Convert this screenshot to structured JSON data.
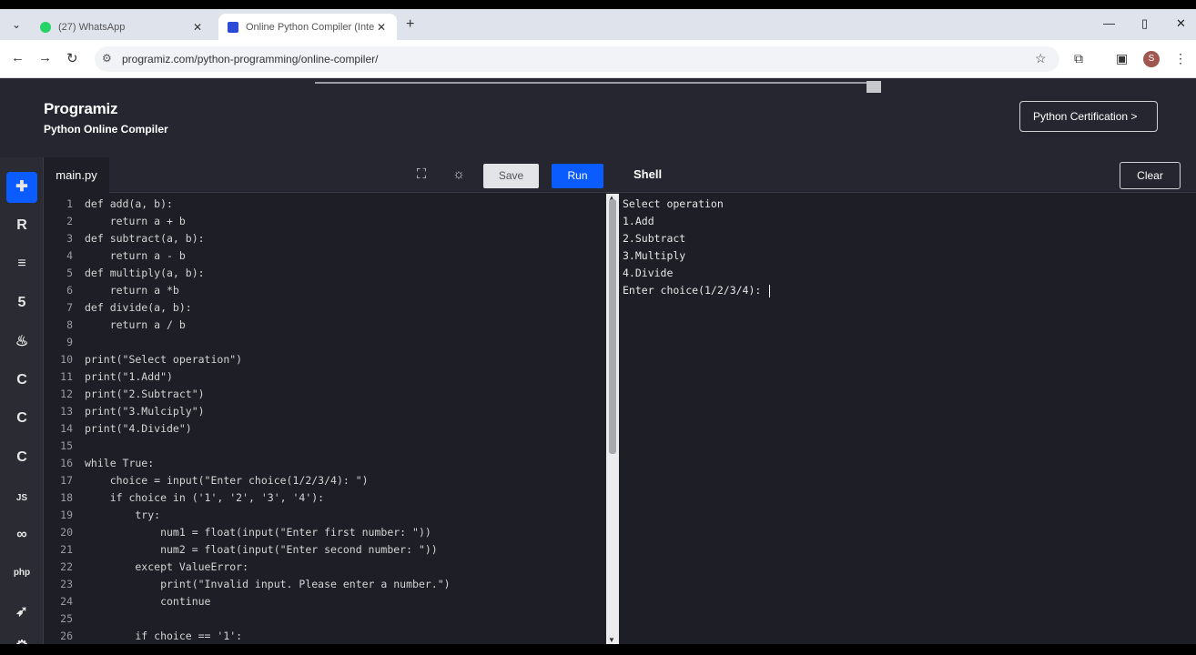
{
  "browser": {
    "tabs": [
      {
        "title": "(27) WhatsApp",
        "favicon_color": "#25d366"
      },
      {
        "title": "Online Python Compiler (Inte p",
        "favicon_color": "#2b4bd6"
      }
    ],
    "url": "programiz.com/python-programming/online-compiler/",
    "profile_initial": "S"
  },
  "site": {
    "logo": "Programiz",
    "subtitle": "Python Online Compiler",
    "cert_button": "Python Certification >"
  },
  "sidebar": {
    "items": [
      {
        "name": "python",
        "glyph": "✚"
      },
      {
        "name": "r",
        "glyph": "R"
      },
      {
        "name": "sql",
        "glyph": "≡"
      },
      {
        "name": "html",
        "glyph": "5"
      },
      {
        "name": "java",
        "glyph": "♨"
      },
      {
        "name": "c",
        "glyph": "C"
      },
      {
        "name": "cpp",
        "glyph": "C"
      },
      {
        "name": "csharp",
        "glyph": "C"
      },
      {
        "name": "js",
        "glyph": "JS"
      },
      {
        "name": "go",
        "glyph": "∞"
      },
      {
        "name": "php",
        "glyph": "php"
      },
      {
        "name": "swift",
        "glyph": "➶"
      },
      {
        "name": "rust",
        "glyph": "⚙"
      }
    ]
  },
  "editor": {
    "file_tab": "main.py",
    "save_label": "Save",
    "run_label": "Run",
    "shell_label": "Shell",
    "clear_label": "Clear",
    "lines": [
      {
        "n": "1",
        "code": "def add(a, b):"
      },
      {
        "n": "2",
        "code": "    return a + b"
      },
      {
        "n": "3",
        "code": "def subtract(a, b):"
      },
      {
        "n": "4",
        "code": "    return a - b"
      },
      {
        "n": "5",
        "code": "def multiply(a, b):"
      },
      {
        "n": "6",
        "code": "    return a *b"
      },
      {
        "n": "7",
        "code": "def divide(a, b):"
      },
      {
        "n": "8",
        "code": "    return a / b"
      },
      {
        "n": "9",
        "code": ""
      },
      {
        "n": "10",
        "code": "print(\"Select operation\")"
      },
      {
        "n": "11",
        "code": "print(\"1.Add\")"
      },
      {
        "n": "12",
        "code": "print(\"2.Subtract\")"
      },
      {
        "n": "13",
        "code": "print(\"3.Mulciply\")"
      },
      {
        "n": "14",
        "code": "print(\"4.Divide\")"
      },
      {
        "n": "15",
        "code": ""
      },
      {
        "n": "16",
        "code": "while True:"
      },
      {
        "n": "17",
        "code": "    choice = input(\"Enter choice(1/2/3/4): \")"
      },
      {
        "n": "18",
        "code": "    if choice in ('1', '2', '3', '4'):"
      },
      {
        "n": "19",
        "code": "        try:"
      },
      {
        "n": "20",
        "code": "            num1 = float(input(\"Enter first number: \"))"
      },
      {
        "n": "21",
        "code": "            num2 = float(input(\"Enter second number: \"))"
      },
      {
        "n": "22",
        "code": "        except ValueError:"
      },
      {
        "n": "23",
        "code": "            print(\"Invalid input. Please enter a number.\")"
      },
      {
        "n": "24",
        "code": "            continue"
      },
      {
        "n": "25",
        "code": ""
      },
      {
        "n": "26",
        "code": "        if choice == '1':"
      }
    ]
  },
  "output": {
    "lines": [
      "Select operation",
      "1.Add",
      "2.Subtract",
      "3.Multiply",
      "4.Divide",
      "Enter choice(1/2/3/4): "
    ]
  }
}
